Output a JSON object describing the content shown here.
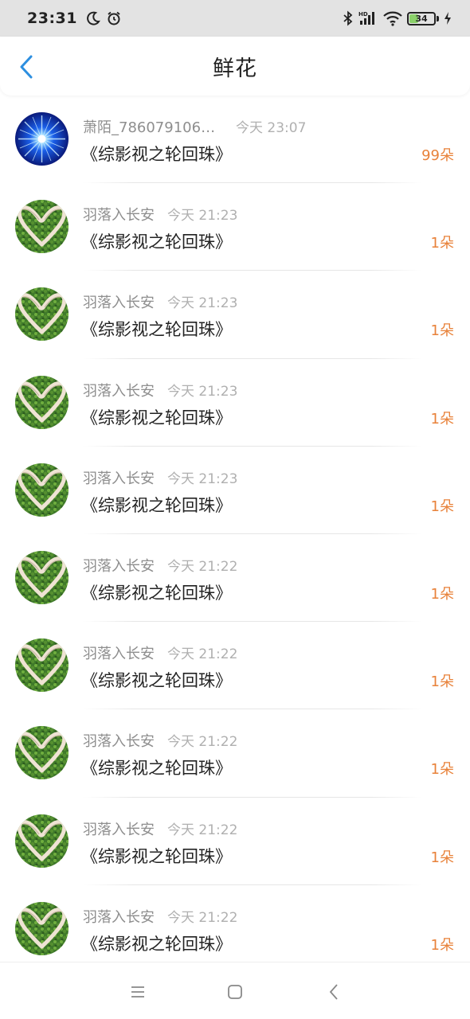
{
  "status_bar": {
    "time": "23:31",
    "battery_level": "34",
    "battery_color": "#8bd16a",
    "left_icons": [
      "moon-icon",
      "alarm-icon"
    ],
    "right_icons": [
      "bluetooth-icon",
      "hd-signal-icon",
      "wifi-icon",
      "battery-icon",
      "charging-icon"
    ],
    "hd_label": "HD"
  },
  "header": {
    "title": "鲜花",
    "back_icon": "chevron-left-icon",
    "accent_color": "#2d8fe0"
  },
  "list": {
    "count_color": "#e8823a",
    "items": [
      {
        "user": "萧陌_7860791066...",
        "time": "今天 23:07",
        "book": "《综影视之轮回珠》",
        "count": "99朵",
        "avatar": "blue-starburst"
      },
      {
        "user": "羽落入长安",
        "time": "今天 21:23",
        "book": "《综影视之轮回珠》",
        "count": "1朵",
        "avatar": "green-heart-hands"
      },
      {
        "user": "羽落入长安",
        "time": "今天 21:23",
        "book": "《综影视之轮回珠》",
        "count": "1朵",
        "avatar": "green-heart-hands"
      },
      {
        "user": "羽落入长安",
        "time": "今天 21:23",
        "book": "《综影视之轮回珠》",
        "count": "1朵",
        "avatar": "green-heart-hands"
      },
      {
        "user": "羽落入长安",
        "time": "今天 21:23",
        "book": "《综影视之轮回珠》",
        "count": "1朵",
        "avatar": "green-heart-hands"
      },
      {
        "user": "羽落入长安",
        "time": "今天 21:22",
        "book": "《综影视之轮回珠》",
        "count": "1朵",
        "avatar": "green-heart-hands"
      },
      {
        "user": "羽落入长安",
        "time": "今天 21:22",
        "book": "《综影视之轮回珠》",
        "count": "1朵",
        "avatar": "green-heart-hands"
      },
      {
        "user": "羽落入长安",
        "time": "今天 21:22",
        "book": "《综影视之轮回珠》",
        "count": "1朵",
        "avatar": "green-heart-hands"
      },
      {
        "user": "羽落入长安",
        "time": "今天 21:22",
        "book": "《综影视之轮回珠》",
        "count": "1朵",
        "avatar": "green-heart-hands"
      },
      {
        "user": "羽落入长安",
        "time": "今天 21:22",
        "book": "《综影视之轮回珠》",
        "count": "1朵",
        "avatar": "green-heart-hands"
      }
    ]
  },
  "nav_bar": {
    "buttons": [
      "menu-icon",
      "home-square-icon",
      "back-triangle-icon"
    ]
  }
}
